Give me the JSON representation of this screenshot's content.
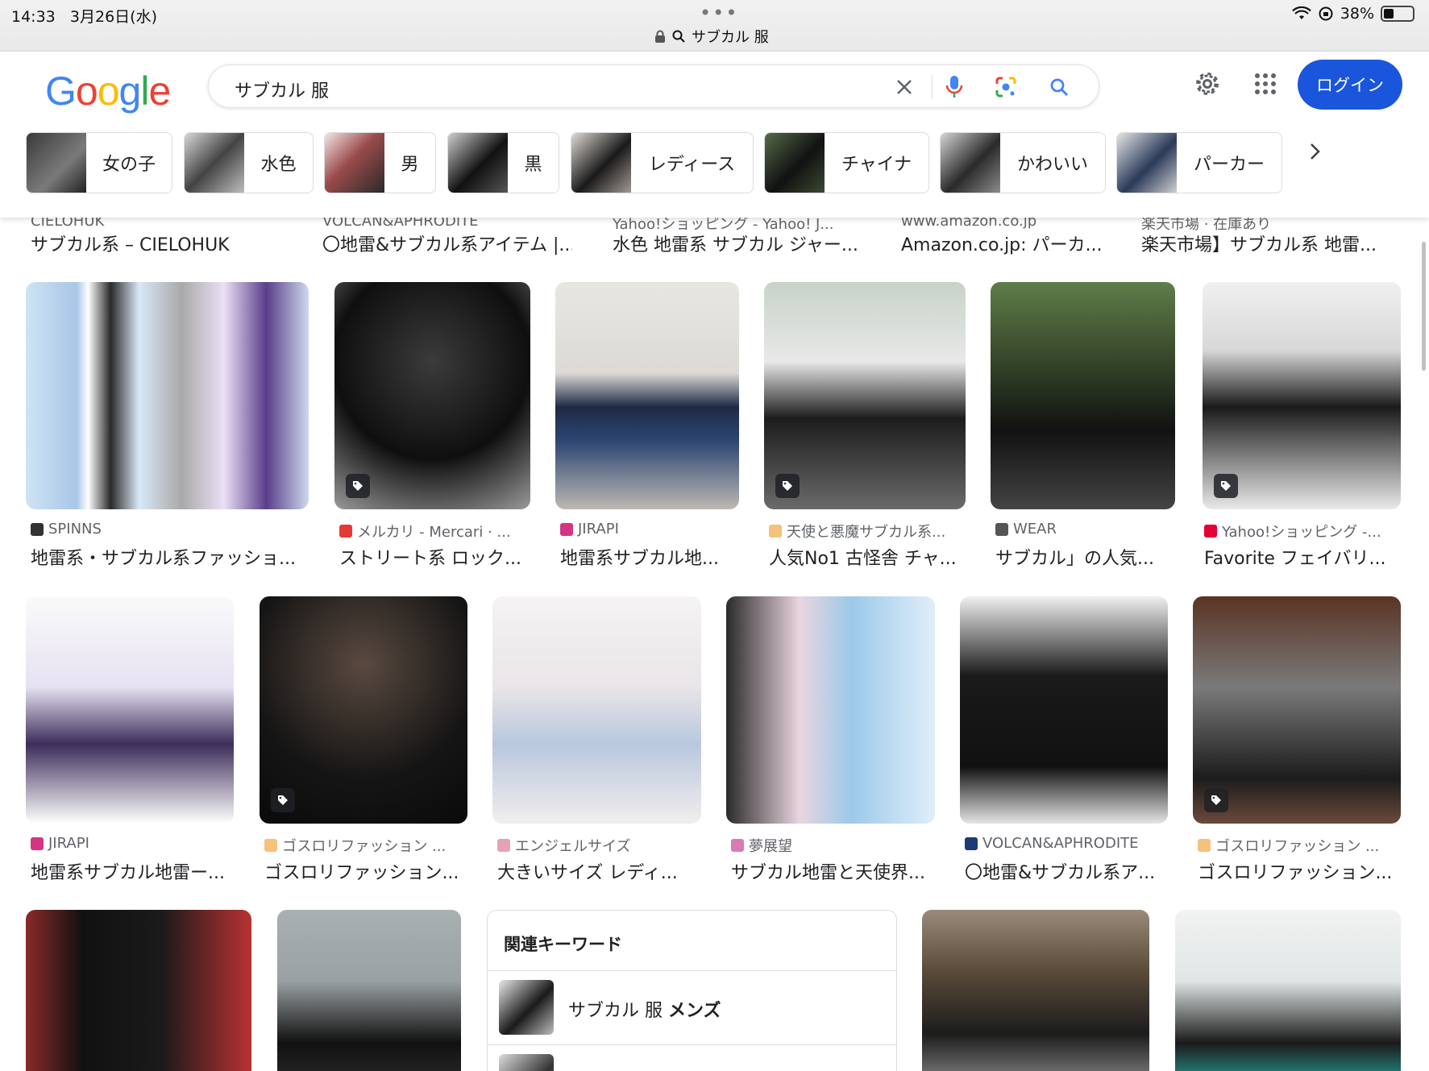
{
  "status": {
    "time": "14:33",
    "date": "3月26日(水)",
    "battery": "38%",
    "address": "サブカル 服"
  },
  "header": {
    "logo": "Google",
    "query": "サブカル 服",
    "login": "ログイン"
  },
  "chips": [
    {
      "label": "女の子"
    },
    {
      "label": "水色"
    },
    {
      "label": "男"
    },
    {
      "label": "黒"
    },
    {
      "label": "レディース"
    },
    {
      "label": "チャイナ"
    },
    {
      "label": "かわいい"
    },
    {
      "label": "パーカー"
    }
  ],
  "top_captions": [
    {
      "source": "CIELOHUK",
      "title": "サブカル系 – CIELOHUK"
    },
    {
      "source": "VOLCAN&APHRODITE",
      "title": "〇地雷&サブカル系アイテム |..."
    },
    {
      "source": "Yahoo!ショッピング - Yahoo! J...",
      "title": "水色 地雷系 サブカル ジャー..."
    },
    {
      "source": "www.amazon.co.jp",
      "title": "Amazon.co.jp: パーカ..."
    },
    {
      "source": "楽天市場 · 在庫あり",
      "title": "楽天市場】サブカル系 地雷..."
    }
  ],
  "row1": [
    {
      "source": "SPINNS",
      "title": "地雷系・サブカル系ファッショ..."
    },
    {
      "source": "メルカリ - Mercari · ...",
      "title": "ストリート系 ロック..."
    },
    {
      "source": "JIRAPI",
      "title": "地雷系サブカル地..."
    },
    {
      "source": "天使と悪魔サブカル系...",
      "title": "人気No1 古怪舎 チャ..."
    },
    {
      "source": "WEAR",
      "title": "サブカル」の人気..."
    },
    {
      "source": "Yahoo!ショッピング -...",
      "title": "Favorite フェイバリ..."
    }
  ],
  "row2": [
    {
      "source": "JIRAPI",
      "title": "地雷系サブカル地雷ー..."
    },
    {
      "source": "ゴスロリファッション ...",
      "title": "ゴスロリファッション..."
    },
    {
      "source": "エンジェルサイズ",
      "title": "大きいサイズ レディ..."
    },
    {
      "source": "夢展望",
      "title": "サブカル地雷と天使界..."
    },
    {
      "source": "VOLCAN&APHRODITE",
      "title": "〇地雷&サブカル系ア..."
    },
    {
      "source": "ゴスロリファッション ...",
      "title": "ゴスロリファッション..."
    }
  ],
  "related": {
    "title": "関連キーワード",
    "item1_prefix": "サブカル 服 ",
    "item1_bold": "メンズ"
  },
  "colors": {
    "accent": "#1a56db",
    "google_blue": "#4285F4",
    "google_red": "#EA4335",
    "google_yellow": "#FBBC05",
    "google_green": "#34A853"
  }
}
